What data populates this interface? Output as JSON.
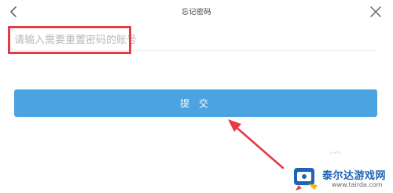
{
  "header": {
    "title": "忘记密码",
    "back_icon": "chevron-left-icon",
    "close_icon": "close-icon"
  },
  "form": {
    "account_input": {
      "placeholder": "请输入需要重置密码的账号",
      "value": ""
    },
    "submit_label": "提 交"
  },
  "colors": {
    "accent": "#4ba3e2",
    "annotation": "#e63a47"
  },
  "watermark": {
    "name": "泰尔达游戏网",
    "url": "www.tairda.com"
  }
}
